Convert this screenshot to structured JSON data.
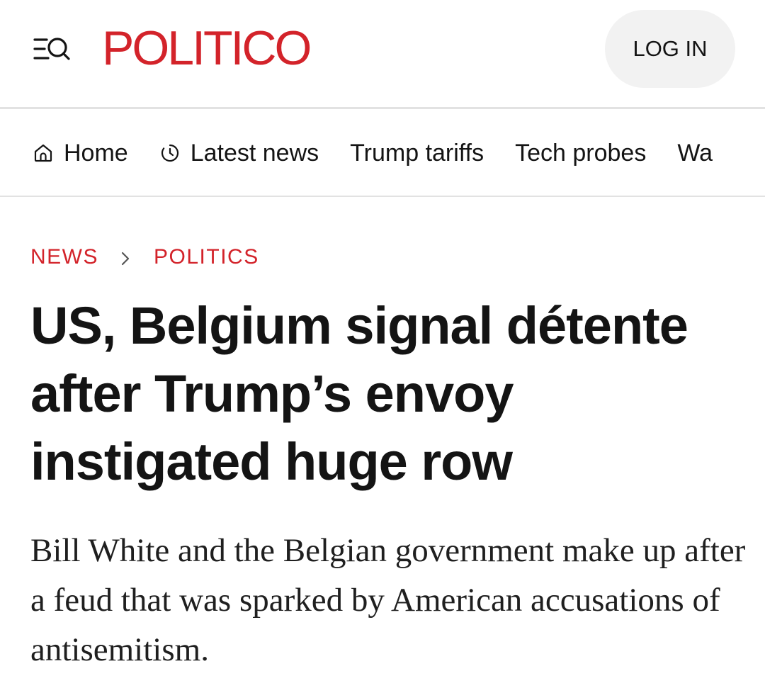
{
  "header": {
    "logo_text": "POLITICO",
    "login_label": "LOG IN",
    "menu_icon": "menu-search-icon"
  },
  "nav": {
    "items": [
      {
        "label": "Home",
        "icon": "home-icon"
      },
      {
        "label": "Latest news",
        "icon": "clock-icon"
      },
      {
        "label": "Trump tariffs"
      },
      {
        "label": "Tech probes"
      },
      {
        "label": "Wa"
      }
    ]
  },
  "breadcrumb": {
    "items": [
      "NEWS",
      "POLITICS"
    ]
  },
  "article": {
    "headline": "US, Belgium signal détente after Trump’s envoy instigated huge row",
    "dek": "Bill White and the Belgian government make up after a feud that was sparked by American accusations of antisemitism."
  },
  "colors": {
    "brand": "#d3232a",
    "text": "#141414",
    "button_bg": "#f2f2f2",
    "divider": "#e2e2e2"
  }
}
